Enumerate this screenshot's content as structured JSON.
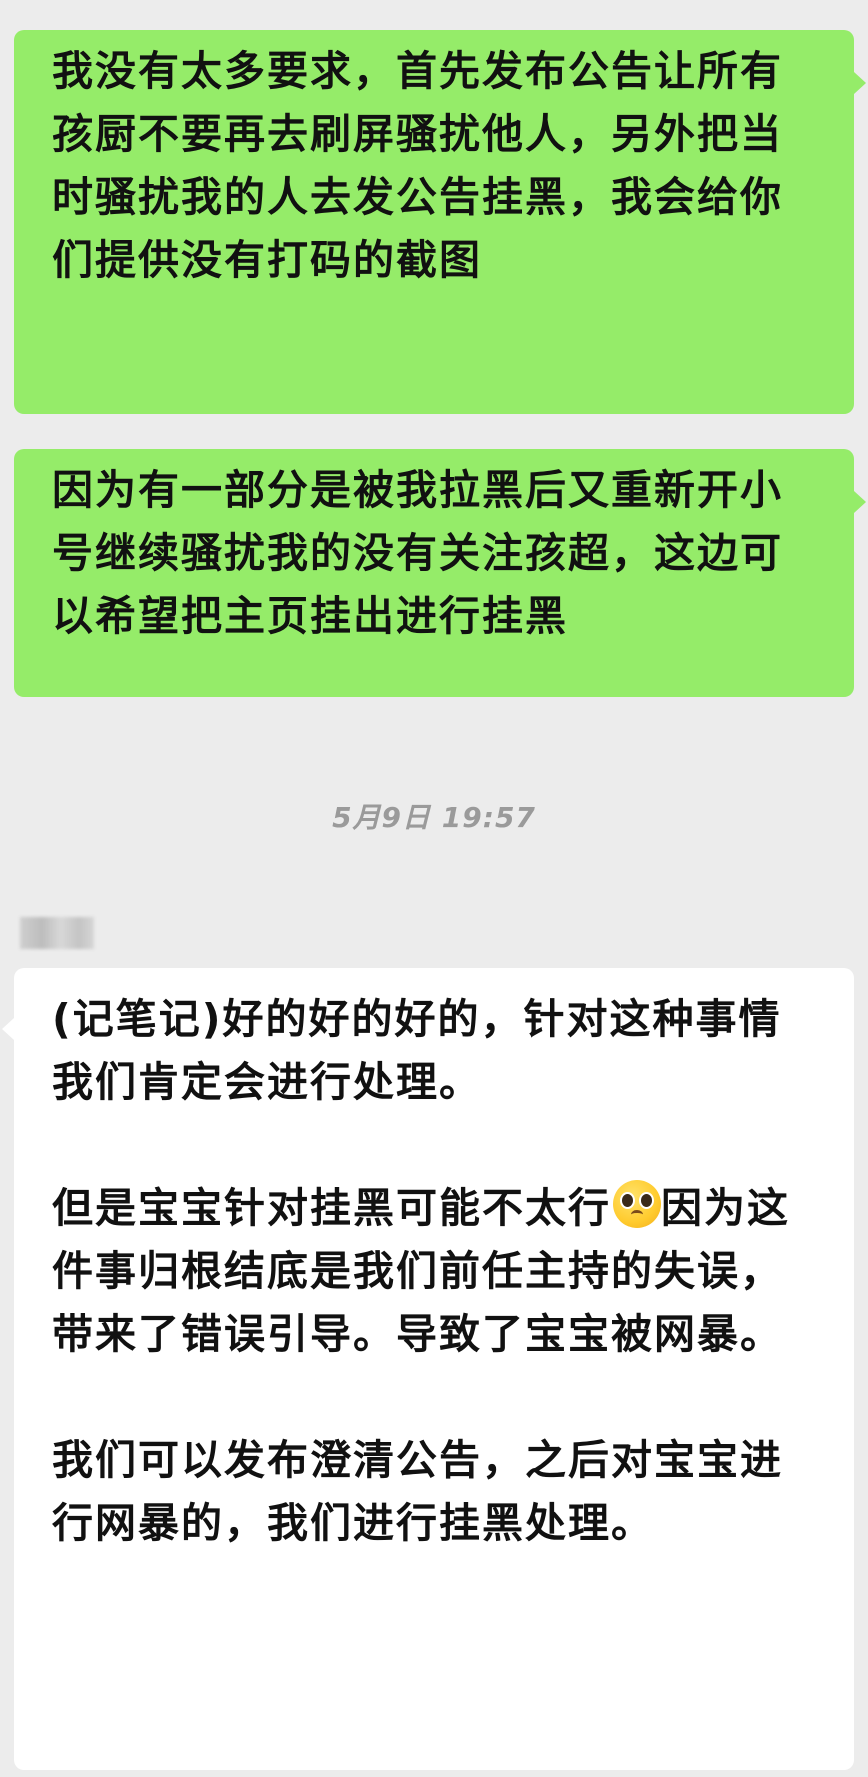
{
  "messages": {
    "out_1": "我没有太多要求，首先发布公告让所有孩厨不要再去刷屏骚扰他人，另外把当时骚扰我的人去发公告挂黑，我会给你们提供没有打码的截图",
    "out_2": "因为有一部分是被我拉黑后又重新开小号继续骚扰我的没有关注孩超，这边可以希望把主页挂出进行挂黑",
    "in_1": {
      "para_1": "(记笔记)好的好的好的，针对这种事情我们肯定会进行处理。",
      "para_2_before_emoji": "但是宝宝针对挂黑可能不太行",
      "emoji": "pleading-face",
      "para_2_after_emoji": "因为这件事归根结底是我们前任主持的失误，带来了错误引导。导致了宝宝被网暴。",
      "para_3": "我们可以发布澄清公告，之后对宝宝进行网暴的，我们进行挂黑处理。"
    }
  },
  "timestamp": "5月9日 19:57",
  "colors": {
    "background": "#ececec",
    "outgoing_bubble": "#95ec69",
    "incoming_bubble": "#ffffff",
    "timestamp_text": "#9a9a9a"
  }
}
